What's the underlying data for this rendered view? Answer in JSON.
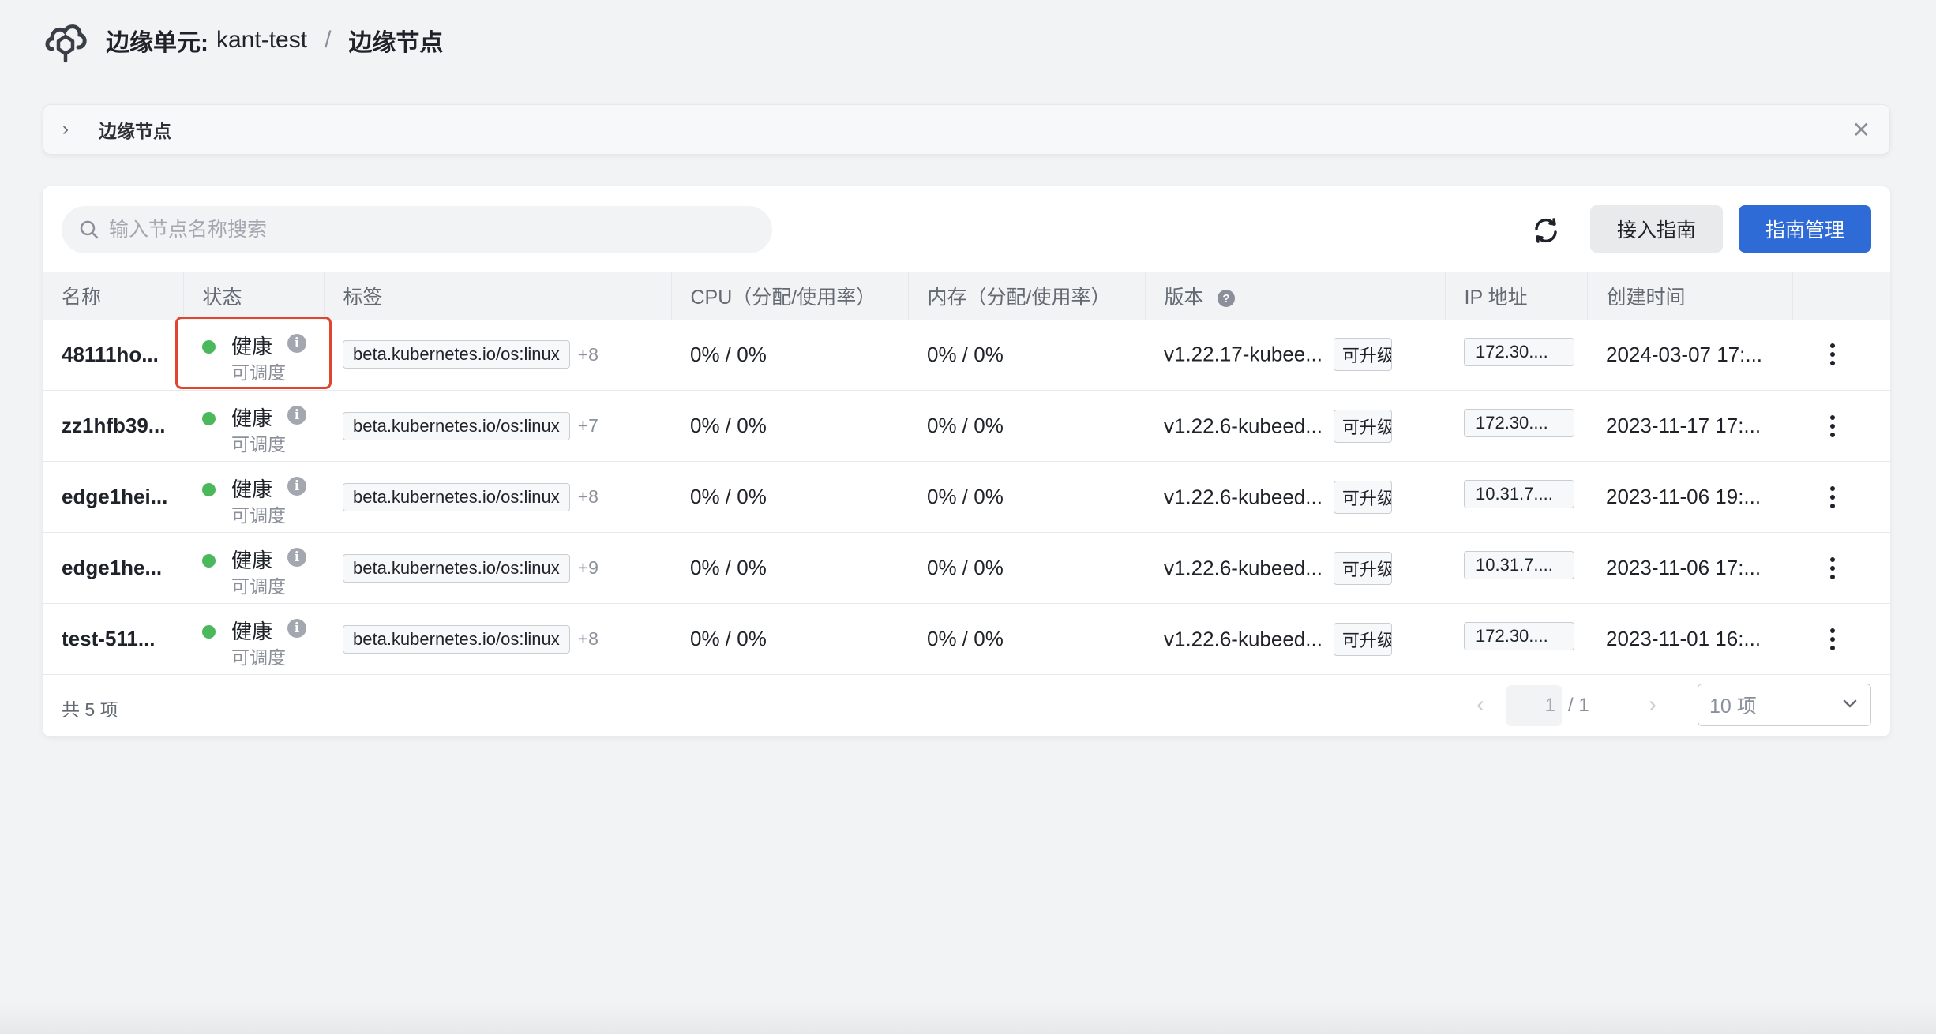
{
  "breadcrumb": {
    "unit_label": "边缘单元:",
    "unit_name": "kant-test",
    "separator": "/",
    "page": "边缘节点"
  },
  "collapse_bar": {
    "title": "边缘节点"
  },
  "toolbar": {
    "search_placeholder": "输入节点名称搜索",
    "guide_button": "接入指南",
    "manage_button": "指南管理"
  },
  "table": {
    "columns": [
      "名称",
      "状态",
      "标签",
      "CPU（分配/使用率）",
      "内存（分配/使用率）",
      "版本",
      "IP 地址",
      "创建时间"
    ],
    "rows": [
      {
        "name": "48111ho...",
        "status": "健康",
        "schedule": "可调度",
        "tag": "beta.kubernetes.io/os:linux",
        "more": "+8",
        "cpu": "0% / 0%",
        "mem": "0% / 0%",
        "version": "v1.22.17-kubee...",
        "upgrade": "可升级",
        "ip": "172.30....",
        "created": "2024-03-07 17:..."
      },
      {
        "name": "zz1hfb39...",
        "status": "健康",
        "schedule": "可调度",
        "tag": "beta.kubernetes.io/os:linux",
        "more": "+7",
        "cpu": "0% / 0%",
        "mem": "0% / 0%",
        "version": "v1.22.6-kubeed...",
        "upgrade": "可升级",
        "ip": "172.30....",
        "created": "2023-11-17 17:..."
      },
      {
        "name": "edge1hei...",
        "status": "健康",
        "schedule": "可调度",
        "tag": "beta.kubernetes.io/os:linux",
        "more": "+8",
        "cpu": "0% / 0%",
        "mem": "0% / 0%",
        "version": "v1.22.6-kubeed...",
        "upgrade": "可升级",
        "ip": "10.31.7....",
        "created": "2023-11-06 19:..."
      },
      {
        "name": "edge1he...",
        "status": "健康",
        "schedule": "可调度",
        "tag": "beta.kubernetes.io/os:linux",
        "more": "+9",
        "cpu": "0% / 0%",
        "mem": "0% / 0%",
        "version": "v1.22.6-kubeed...",
        "upgrade": "可升级",
        "ip": "10.31.7....",
        "created": "2023-11-06 17:..."
      },
      {
        "name": "test-511...",
        "status": "健康",
        "schedule": "可调度",
        "tag": "beta.kubernetes.io/os:linux",
        "more": "+8",
        "cpu": "0% / 0%",
        "mem": "0% / 0%",
        "version": "v1.22.6-kubeed...",
        "upgrade": "可升级",
        "ip": "172.30....",
        "created": "2023-11-01 16:..."
      }
    ]
  },
  "pagination": {
    "total": "共 5 项",
    "current": "1",
    "pages": "/ 1",
    "page_size": "10 项"
  },
  "colors": {
    "primary": "#2f6bd6",
    "healthy": "#4cb85c",
    "highlight": "#e0452f"
  }
}
